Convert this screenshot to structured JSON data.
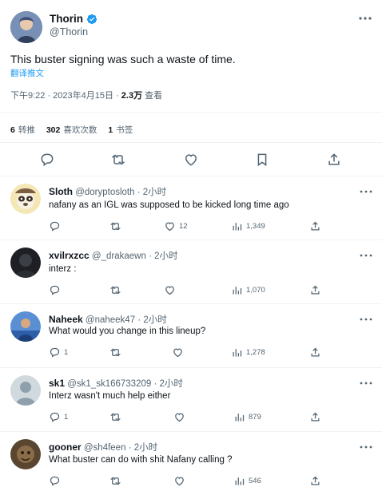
{
  "tweet": {
    "author_name": "Thorin",
    "author_handle": "@Thorin",
    "text": "This buster signing was such a waste of time.",
    "translate_label": "翻译推文",
    "time": "下午9:22 · 2023年4月15日 · ",
    "views_count": "2.3万",
    "views_label": " 查看",
    "stats": {
      "reposts_count": "6",
      "reposts_label": "转推",
      "quotes_count": "302",
      "quotes_label": "喜欢次数",
      "bookmarks_count": "1",
      "bookmarks_label": "书签"
    }
  },
  "replies": [
    {
      "name": "Sloth",
      "handle": "@doryptosloth",
      "time": "2小时",
      "text": "nafany as an IGL was supposed to be kicked long time ago",
      "reply_count": "",
      "repost_count": "",
      "like_count": "12",
      "view_count": "1,349"
    },
    {
      "name": "xvilrxzcc",
      "handle": "@_drakaewn",
      "time": "2小时",
      "text": "interz :",
      "reply_count": "",
      "repost_count": "",
      "like_count": "",
      "view_count": "1,070"
    },
    {
      "name": "Naheek",
      "handle": "@naheek47",
      "time": "2小时",
      "text": "What would you change in this lineup?",
      "reply_count": "1",
      "repost_count": "",
      "like_count": "",
      "view_count": "1,278"
    },
    {
      "name": "sk1",
      "handle": "@sk1_sk166733209",
      "time": "2小时",
      "text": "Interz wasn't much help either",
      "reply_count": "1",
      "repost_count": "",
      "like_count": "",
      "view_count": "879"
    },
    {
      "name": "gooner",
      "handle": "@sh4feen",
      "time": "2小时",
      "text": "What buster can do with shit Nafany calling ?",
      "reply_count": "",
      "repost_count": "",
      "like_count": "",
      "view_count": "546"
    }
  ],
  "colors": {
    "accent": "#1d9bf0",
    "text": "#0f1419",
    "secondary": "#536471",
    "divider": "#eff3f4"
  },
  "icons": [
    "verified-badge-icon",
    "more-icon",
    "reply-icon",
    "repost-icon",
    "like-icon",
    "bookmark-icon",
    "share-icon",
    "views-icon"
  ]
}
